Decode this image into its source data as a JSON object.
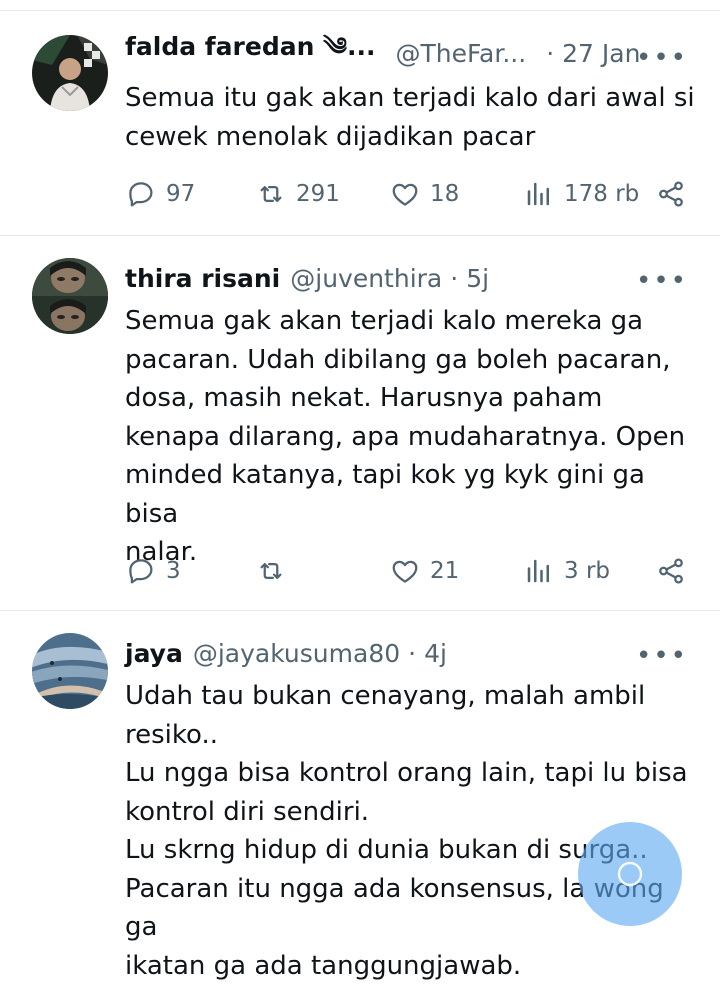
{
  "colors": {
    "accent": "#1d9bf0",
    "text": "#0f1419",
    "muted": "#536471",
    "divider": "#e6e9ec"
  },
  "tweets": [
    {
      "name": "falda faredan ༄...",
      "handle": "@TheFar...",
      "sep": "·",
      "time": "27 Jan",
      "more": "•••",
      "text": "Semua itu gak akan terjadi kalo dari awal si\ncewek menolak dijadikan pacar",
      "replies": "97",
      "retweets": "291",
      "likes": "18",
      "views": "178 rb"
    },
    {
      "name": "thira risani",
      "handle": "@juventhira",
      "sep": "·",
      "time": "5j",
      "more": "•••",
      "text": "Semua gak akan terjadi kalo mereka ga\npacaran. Udah dibilang ga boleh pacaran,\ndosa, masih nekat. Harusnya paham\nkenapa dilarang, apa mudaharatnya. Open\nminded katanya, tapi kok yg kyk gini ga bisa\nnalar.",
      "replies": "3",
      "retweets": "",
      "likes": "21",
      "views": "3 rb"
    },
    {
      "name": "jaya",
      "handle": "@jayakusuma80",
      "sep": "·",
      "time": "4j",
      "more": "•••",
      "text": "Udah tau bukan cenayang, malah ambil\nresiko..\nLu ngga bisa kontrol orang lain, tapi lu bisa\nkontrol diri sendiri.\nLu skrng hidup di dunia bukan di surga..\nPacaran itu ngga ada konsensus, la wong ga\nikatan ga ada tanggungjawab."
    }
  ],
  "icons": {
    "reply": "reply-icon",
    "retweet": "retweet-icon",
    "like": "heart-icon",
    "views": "views-icon",
    "share": "share-icon",
    "fab": "compose-icon"
  }
}
